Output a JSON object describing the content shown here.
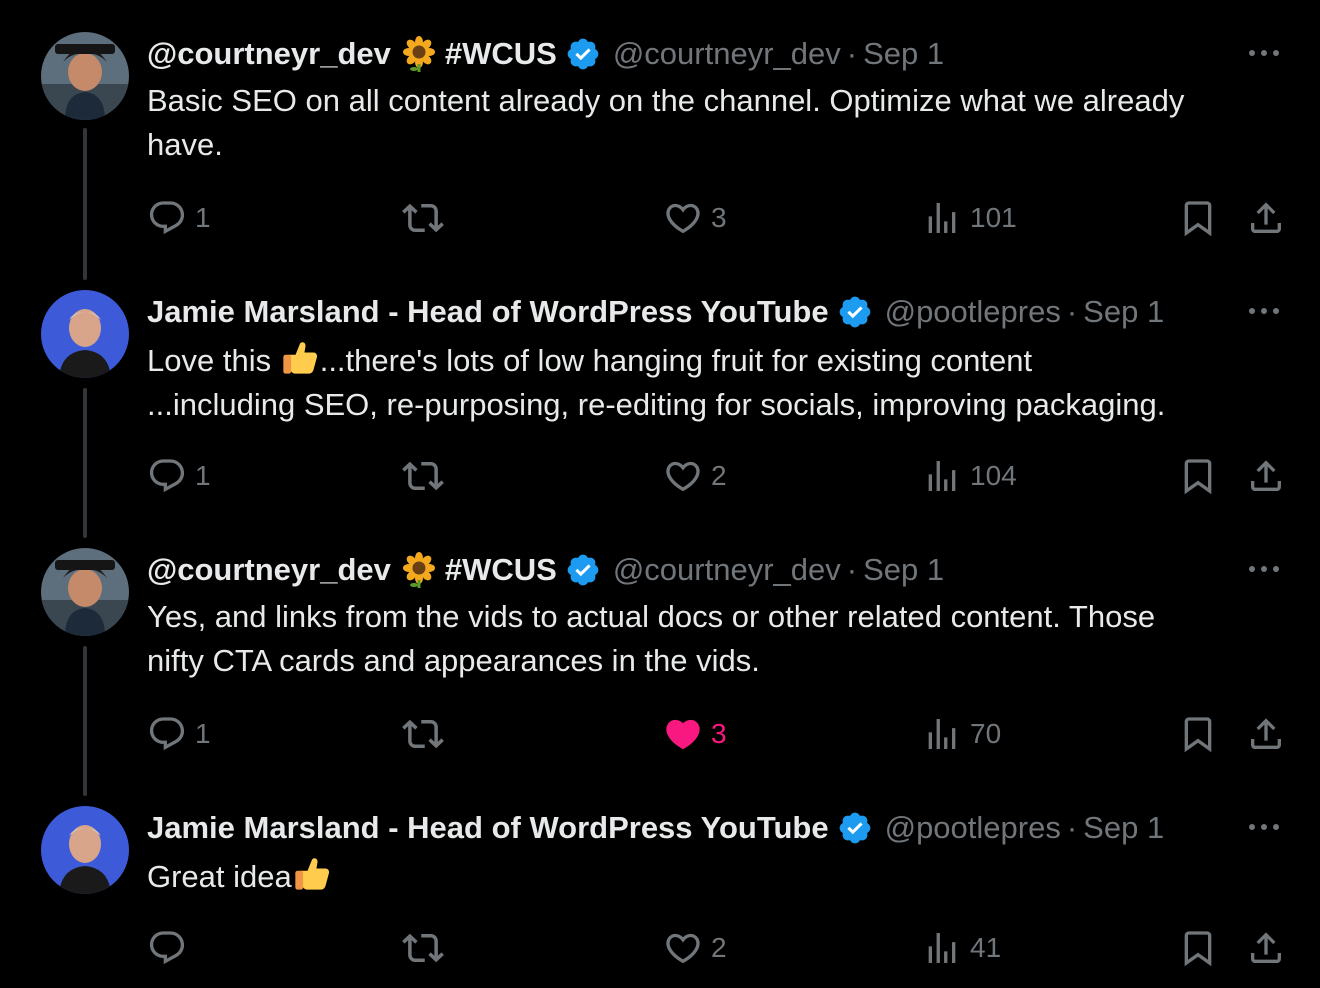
{
  "tweets": [
    {
      "name": "@courtneyr_dev",
      "emoji": "sunflower-icon",
      "tag": "#WCUS",
      "verified": true,
      "handle": "@courtneyr_dev",
      "date": "Sep 1",
      "text_lines": [
        "Basic SEO on all content already on the channel. Optimize what we already",
        "have."
      ],
      "replies": "1",
      "reposts": "",
      "likes": "3",
      "liked": false,
      "views": "101"
    },
    {
      "name": "Jamie Marsland - Head of WordPress YouTube",
      "verified": true,
      "handle": "@pootlepres",
      "date": "Sep 1",
      "text_parts": [
        "Love this ",
        "...there's lots of low hanging fruit for existing content"
      ],
      "text_line2": "...including SEO, re-purposing, re-editing for socials, improving packaging.",
      "replies": "1",
      "reposts": "",
      "likes": "2",
      "liked": false,
      "views": "104"
    },
    {
      "name": "@courtneyr_dev",
      "emoji": "sunflower-icon",
      "tag": "#WCUS",
      "verified": true,
      "handle": "@courtneyr_dev",
      "date": "Sep 1",
      "text_lines": [
        "Yes, and links from the vids to actual docs or other related content. Those",
        "nifty CTA cards and appearances in the vids."
      ],
      "replies": "1",
      "reposts": "",
      "likes": "3",
      "liked": true,
      "views": "70"
    },
    {
      "name": "Jamie Marsland - Head of WordPress YouTube",
      "verified": true,
      "handle": "@pootlepres",
      "date": "Sep 1",
      "text": "Great idea",
      "replies": "",
      "reposts": "",
      "likes": "2",
      "liked": false,
      "views": "41"
    }
  ],
  "header_separator": "·",
  "colors": {
    "background": "#000000",
    "text": "#e7e9ea",
    "muted": "#71767b",
    "verified": "#1d9bf0",
    "like_active": "#f91880"
  }
}
